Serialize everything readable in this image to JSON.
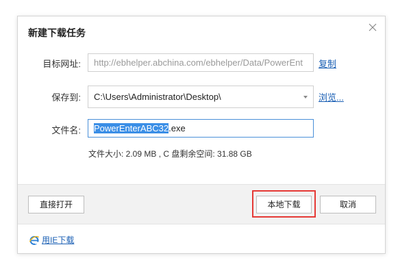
{
  "dialog": {
    "title": "新建下载任务",
    "url_label": "目标网址:",
    "url_value": "http://ebhelper.abchina.com/ebhelper/Data/PowerEnt",
    "copy_link": "复制",
    "save_label": "保存到:",
    "save_path": "C:\\Users\\Administrator\\Desktop\\",
    "browse_link": "浏览...",
    "filename_label": "文件名:",
    "filename_selected": "PowerEnterABC32",
    "filename_ext": ".exe",
    "info": "文件大小: 2.09 MB , C 盘剩余空间: 31.88 GB",
    "direct_open_button": "直接打开",
    "local_download_button": "本地下载",
    "cancel_button": "取消",
    "ie_download_link": "用IE下载"
  },
  "colors": {
    "highlight": "#e53935",
    "link": "#1a5fb4",
    "selection": "#3a8ee6"
  }
}
